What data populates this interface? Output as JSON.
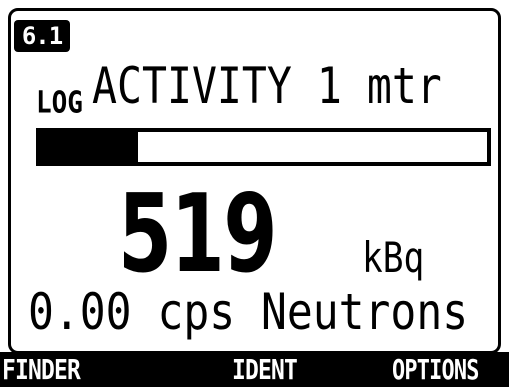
{
  "device": {
    "version_badge": "6.1"
  },
  "reading": {
    "scale_label": "LOG",
    "title": "ACTIVITY 1 mtr",
    "bar_fill_fraction": 0.22,
    "value": "519",
    "unit": "kBq",
    "neutron_text": "0.00 cps Neutrons"
  },
  "softkeys": {
    "left": "FINDER",
    "center": "IDENT",
    "right": "OPTIONS"
  },
  "colors": {
    "foreground": "#000000",
    "background": "#ffffff"
  }
}
